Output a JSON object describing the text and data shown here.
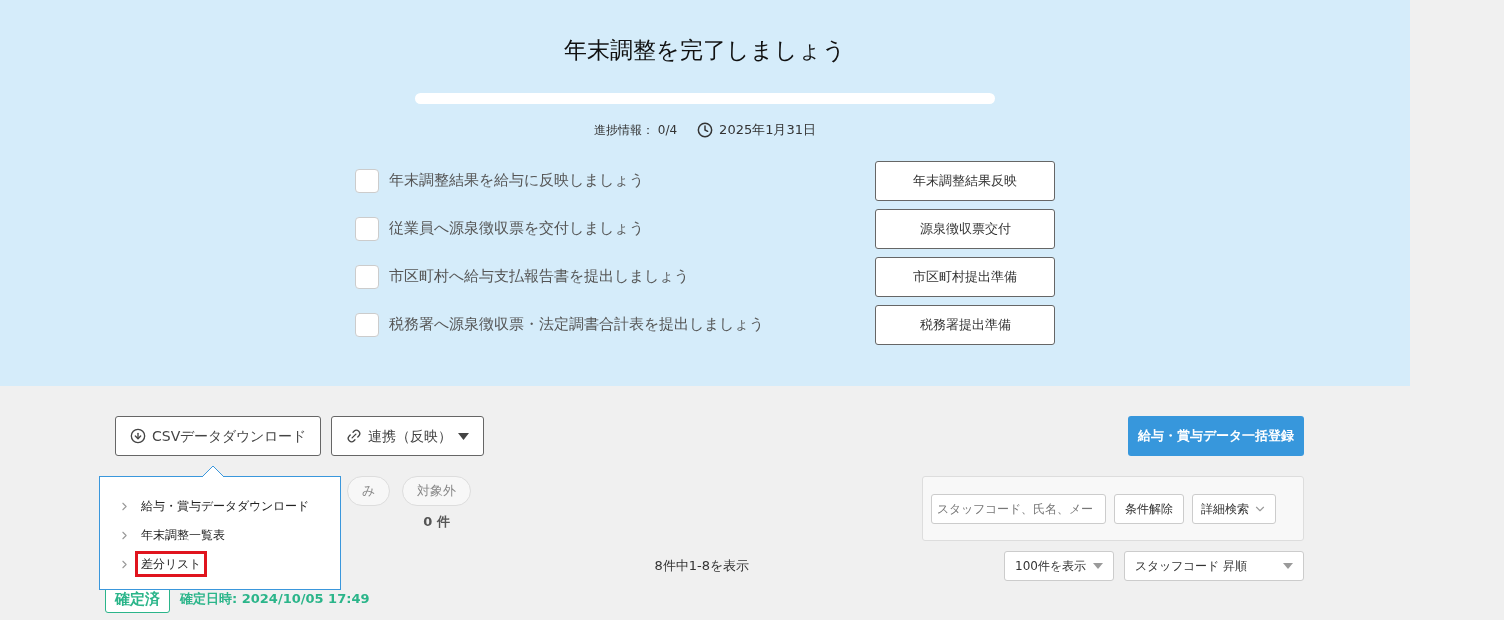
{
  "header": {
    "title": "年末調整を完了しましょう",
    "progress": {
      "level": 0
    },
    "progress_label": "進捗情報： 0/4",
    "deadline": "2025年1月31日"
  },
  "tasks": [
    {
      "label": "年末調整結果を給与に反映しましょう",
      "checked": false,
      "button": "年末調整結果反映"
    },
    {
      "label": "従業員へ源泉徴収票を交付しましょう",
      "checked": false,
      "button": "源泉徴収票交付"
    },
    {
      "label": "市区町村へ給与支払報告書を提出しましょう",
      "checked": false,
      "button": "市区町村提出準備"
    },
    {
      "label": "税務署へ源泉徴収票・法定調書合計表を提出しましょう",
      "checked": false,
      "button": "税務署提出準備"
    }
  ],
  "toolbar": {
    "csv_button": "CSVデータダウンロード",
    "link_button": "連携（反映）",
    "bulk_button": "給与・賞与データ一括登録"
  },
  "csv_menu": [
    {
      "label": "給与・賞与データダウンロード",
      "highlighted": false
    },
    {
      "label": "年末調整一覧表",
      "highlighted": false
    },
    {
      "label": "差分リスト",
      "highlighted": true
    }
  ],
  "status_filters": [
    {
      "label": "み"
    },
    {
      "label": "対象外",
      "count": "0 件"
    }
  ],
  "search": {
    "placeholder": "スタッフコード、氏名、メー",
    "clear_button": "条件解除",
    "advanced_button": "詳細検索"
  },
  "result_count": "8件中1-8を表示",
  "per_page": "100件を表示",
  "sort": "スタッフコード 昇順",
  "record": {
    "status": "確定済",
    "confirmed_at": "確定日時: 2024/10/05 17:49"
  }
}
